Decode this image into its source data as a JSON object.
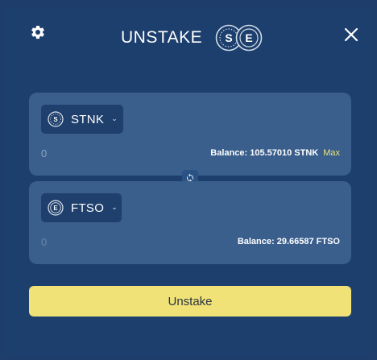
{
  "header": {
    "title": "UNSTAKE",
    "settings_icon": "gear-icon",
    "close_icon": "close-icon",
    "logo": "staking-logo-icon"
  },
  "from": {
    "token": "STNK",
    "token_icon": "stnk-token-icon",
    "amount_placeholder": "0",
    "balance": "Balance: 105.57010 STNK",
    "max_label": "Max"
  },
  "to": {
    "token": "FTSO",
    "token_icon": "ftso-token-icon",
    "amount_placeholder": "0",
    "balance": "Balance: 29.66587 FTSO"
  },
  "swap_icon": "swap-refresh-icon",
  "action": {
    "label": "Unstake"
  },
  "colors": {
    "background": "#1f3d6b",
    "card": "#3a5f8d",
    "select": "#1f3f6c",
    "accent": "#f1e277",
    "max_text": "#e9e27c"
  }
}
